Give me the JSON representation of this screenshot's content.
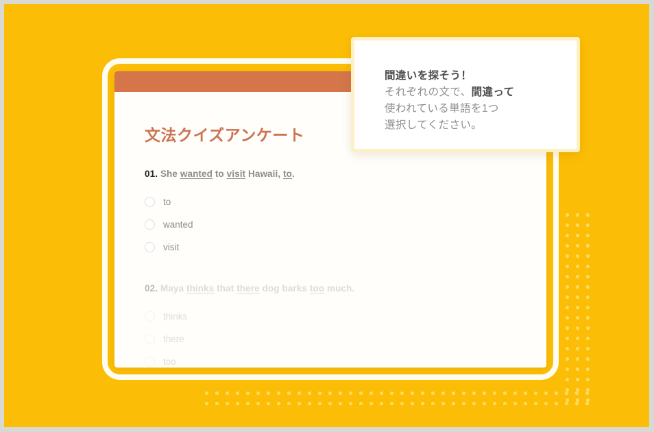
{
  "colors": {
    "canvas_yellow": "#fbbd05",
    "dot_yellow": "#fdd95e",
    "frame_white": "#fffdf2",
    "card_white": "#fffefa",
    "header_orange": "#d4754a",
    "title_orange": "#cc7352",
    "callout_border": "#fdf0c4",
    "page_gray": "#d9d9d4"
  },
  "card": {
    "title": "文法クイズアンケート",
    "questions": [
      {
        "number": "01.",
        "sentence_parts": [
          {
            "text": "She ",
            "underline": false
          },
          {
            "text": "wanted",
            "underline": true
          },
          {
            "text": " to ",
            "underline": false
          },
          {
            "text": "visit",
            "underline": true
          },
          {
            "text": " Hawaii, ",
            "underline": false
          },
          {
            "text": "to",
            "underline": true
          },
          {
            "text": ".",
            "underline": false
          }
        ],
        "sentence_plain": "She wanted to visit Hawaii, to.",
        "options": [
          "to",
          "wanted",
          "visit"
        ],
        "dimmed": false
      },
      {
        "number": "02.",
        "sentence_parts": [
          {
            "text": "Maya ",
            "underline": false
          },
          {
            "text": "thinks",
            "underline": true
          },
          {
            "text": " that ",
            "underline": false
          },
          {
            "text": "there",
            "underline": true
          },
          {
            "text": " dog barks ",
            "underline": false
          },
          {
            "text": "too",
            "underline": true
          },
          {
            "text": " much.",
            "underline": false
          }
        ],
        "sentence_plain": "Maya thinks that there dog barks too much.",
        "options": [
          "thinks",
          "there",
          "too"
        ],
        "dimmed": true
      }
    ]
  },
  "callout": {
    "title": "間違いを探そう！",
    "line1_pre": "それぞれの文で、",
    "line1_bold": "間違って",
    "line2": "使われている単語を1つ",
    "line3": "選択してください。"
  }
}
